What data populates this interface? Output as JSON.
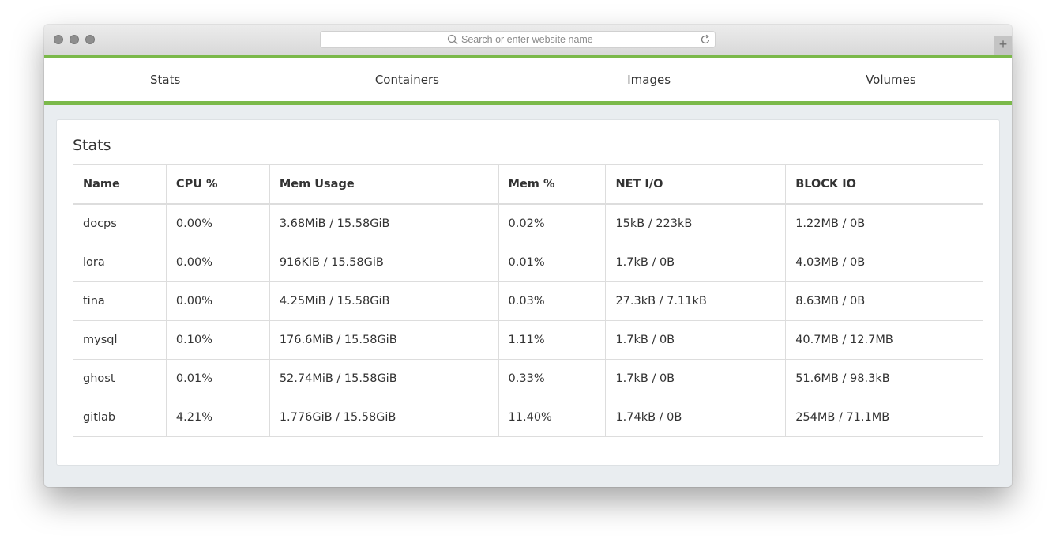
{
  "browser": {
    "search_placeholder": "Search or enter website name",
    "new_tab_label": "+",
    "icons": [
      "search-icon",
      "reload-icon",
      "plus-icon"
    ]
  },
  "colors": {
    "accent": "#7bb94a",
    "background": "#e9edf0"
  },
  "nav": {
    "tabs": [
      {
        "label": "Stats"
      },
      {
        "label": "Containers"
      },
      {
        "label": "Images"
      },
      {
        "label": "Volumes"
      }
    ]
  },
  "panel": {
    "title": "Stats"
  },
  "table": {
    "headers": [
      "Name",
      "CPU %",
      "Mem Usage",
      "Mem %",
      "NET I/O",
      "BLOCK IO"
    ],
    "rows": [
      [
        "docps",
        "0.00%",
        "3.68MiB / 15.58GiB",
        "0.02%",
        "15kB / 223kB",
        "1.22MB / 0B"
      ],
      [
        "lora",
        "0.00%",
        "916KiB / 15.58GiB",
        "0.01%",
        "1.7kB / 0B",
        "4.03MB / 0B"
      ],
      [
        "tina",
        "0.00%",
        "4.25MiB / 15.58GiB",
        "0.03%",
        "27.3kB / 7.11kB",
        "8.63MB / 0B"
      ],
      [
        "mysql",
        "0.10%",
        "176.6MiB / 15.58GiB",
        "1.11%",
        "1.7kB / 0B",
        "40.7MB / 12.7MB"
      ],
      [
        "ghost",
        "0.01%",
        "52.74MiB / 15.58GiB",
        "0.33%",
        "1.7kB / 0B",
        "51.6MB / 98.3kB"
      ],
      [
        "gitlab",
        "4.21%",
        "1.776GiB / 15.58GiB",
        "11.40%",
        "1.74kB / 0B",
        "254MB / 71.1MB"
      ]
    ]
  }
}
